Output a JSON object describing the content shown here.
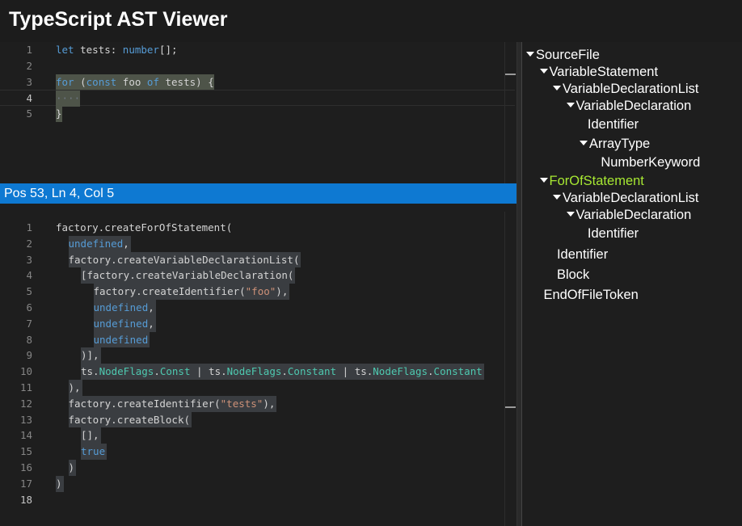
{
  "app": {
    "title": "TypeScript AST Viewer"
  },
  "source_editor": {
    "lines": [
      "1",
      "2",
      "3",
      "4",
      "5"
    ],
    "code": {
      "l1": {
        "kw": "let",
        "name": " tests: ",
        "type": "number",
        "rest": "[];"
      },
      "l3": {
        "kw1": "for",
        "p1": " (",
        "kw2": "const",
        "name": " foo ",
        "kw3": "of",
        "rest": " tests) {"
      },
      "l4": {
        "indent": "····"
      },
      "l5": {
        "close": "}"
      }
    }
  },
  "status_bar": {
    "text": "Pos 53, Ln 4, Col 5"
  },
  "factory_editor": {
    "lines": [
      "1",
      "2",
      "3",
      "4",
      "5",
      "6",
      "7",
      "8",
      "9",
      "10",
      "11",
      "12",
      "13",
      "14",
      "15",
      "16",
      "17",
      "18"
    ],
    "code": {
      "l1": "factory.createForOfStatement(",
      "l2": "undefined",
      "l3": "factory.createVariableDeclarationList(",
      "l4": "[factory.createVariableDeclaration(",
      "l5a": "factory.createIdentifier(",
      "l5b": "\"foo\"",
      "l5c": "),",
      "l6": "undefined",
      "l7": "undefined",
      "l8": "undefined",
      "l9": ")],",
      "l10a": "ts.",
      "l10b": "NodeFlags",
      "l10c": ".",
      "l10d": "Const",
      "l10e": " | ts.",
      "l10f": "NodeFlags",
      "l10g": ".",
      "l10h": "Constant",
      "l10i": " | ts.",
      "l10j": "NodeFlags",
      "l10k": ".",
      "l10l": "Constant",
      "l11": "),",
      "l12a": "factory.createIdentifier(",
      "l12b": "\"tests\"",
      "l12c": "),",
      "l13": "factory.createBlock(",
      "l14": "[],",
      "l15": "true",
      "l16": ")",
      "l17": ")"
    }
  },
  "ast_tree": {
    "nodes": [
      {
        "label": "SourceFile",
        "expanded": true
      },
      {
        "label": "VariableStatement",
        "expanded": true
      },
      {
        "label": "VariableDeclarationList",
        "expanded": true
      },
      {
        "label": "VariableDeclaration",
        "expanded": true
      },
      {
        "label": "Identifier",
        "expanded": false
      },
      {
        "label": "ArrayType",
        "expanded": true
      },
      {
        "label": "NumberKeyword",
        "expanded": false
      },
      {
        "label": "ForOfStatement",
        "expanded": true,
        "selected": true
      },
      {
        "label": "VariableDeclarationList",
        "expanded": true
      },
      {
        "label": "VariableDeclaration",
        "expanded": true
      },
      {
        "label": "Identifier",
        "expanded": false
      },
      {
        "label": "Identifier",
        "expanded": false
      },
      {
        "label": "Block",
        "expanded": false
      },
      {
        "label": "EndOfFileToken",
        "expanded": false
      }
    ]
  },
  "colors": {
    "status_bar": "#0e79d2",
    "selected_node": "#a7e832",
    "keyword": "#569cd6",
    "type": "#4ec9b0",
    "string": "#ce9178"
  }
}
